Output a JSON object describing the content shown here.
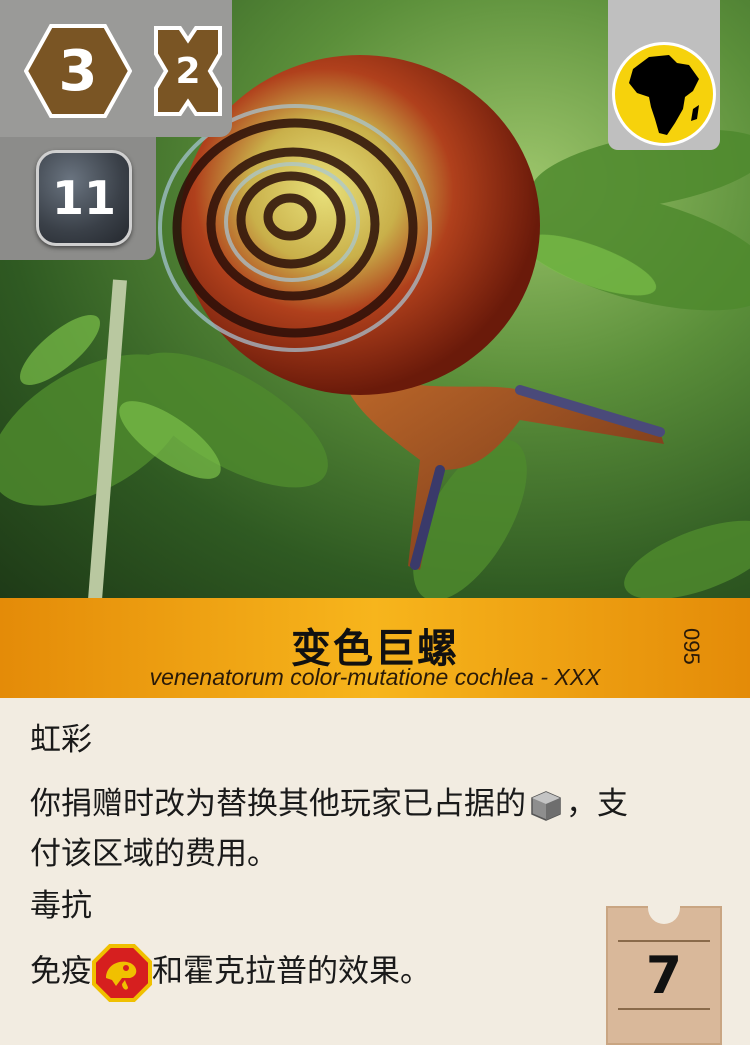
{
  "card": {
    "cost": "3",
    "requirement": "2",
    "victory_points": "11",
    "continent_icon": "africa-icon",
    "title": "变色巨螺",
    "latin_name": "venenatorum color-mutatione cochlea - XXX",
    "card_number": "095",
    "ability1_name": "虹彩",
    "ability1_text_a": "你捐赠时改为替换其他玩家已占据的",
    "ability1_text_b": "，支",
    "ability1_text_c": "付该区域的费用。",
    "ability2_name": "毒抗",
    "ability2_text_a": "免疫",
    "ability2_text_b": "和霍克拉普的效果。",
    "price": "7"
  },
  "colors": {
    "cost_hex": "#7a5524",
    "title_band": "#f2a516",
    "continent": "#f6d20c",
    "text_bg": "#f2ece1"
  },
  "icons": [
    "hexagon-cost-icon",
    "bone-requirement-icon",
    "vp-badge-icon",
    "africa-icon",
    "cube-icon",
    "poison-icon"
  ]
}
